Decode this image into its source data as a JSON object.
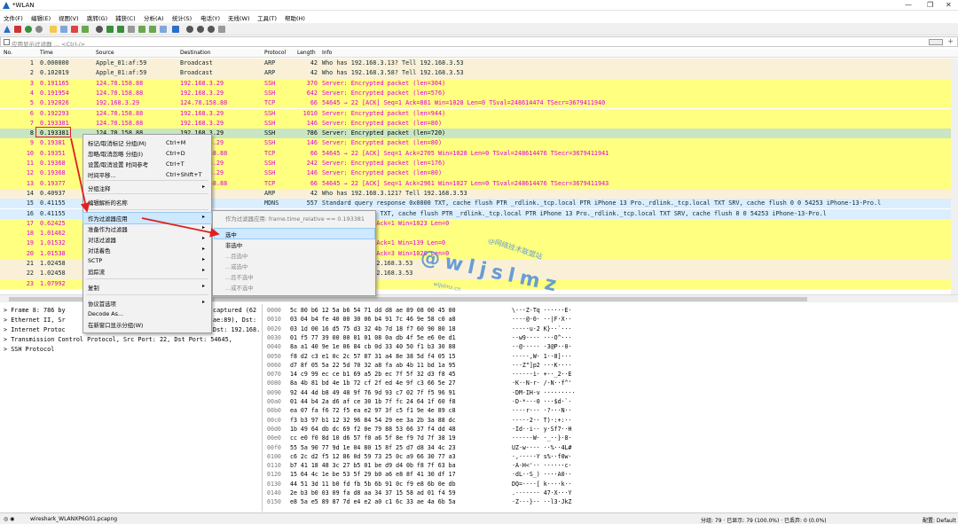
{
  "titlebar": {
    "title": "*WLAN",
    "win_min": "—",
    "win_max": "❐",
    "win_close": "✕"
  },
  "menu": [
    "文件(F)",
    "编辑(E)",
    "视图(V)",
    "跳转(G)",
    "捕获(C)",
    "分析(A)",
    "统计(S)",
    "电话(Y)",
    "无线(W)",
    "工具(T)",
    "帮助(H)"
  ],
  "filter": {
    "placeholder": "应用显示过滤器 … <Ctrl-/>"
  },
  "columns": {
    "no": "No.",
    "time": "Time",
    "source": "Source",
    "destination": "Destination",
    "protocol": "Protocol",
    "length": "Length",
    "info": "Info"
  },
  "packets": [
    {
      "no": "1",
      "time": "0.000000",
      "src": "Apple_01:af:59",
      "dst": "Broadcast",
      "proto": "ARP",
      "len": "42",
      "info": "Who has 192.168.3.13? Tell 192.168.3.53",
      "cls": "bg-arp"
    },
    {
      "no": "2",
      "time": "0.102019",
      "src": "Apple_01:af:59",
      "dst": "Broadcast",
      "proto": "ARP",
      "len": "42",
      "info": "Who has 192.168.3.58? Tell 192.168.3.53",
      "cls": "bg-arp"
    },
    {
      "no": "3",
      "time": "0.191165",
      "src": "124.70.158.88",
      "dst": "192.168.3.29",
      "proto": "SSH",
      "len": "370",
      "info": "Server: Encrypted packet (len=304)",
      "cls": "bg-ssh"
    },
    {
      "no": "4",
      "time": "0.191954",
      "src": "124.70.158.88",
      "dst": "192.168.3.29",
      "proto": "SSH",
      "len": "642",
      "info": "Server: Encrypted packet (len=576)",
      "cls": "bg-ssh"
    },
    {
      "no": "5",
      "time": "0.192026",
      "src": "192.168.3.29",
      "dst": "124.70.158.88",
      "proto": "TCP",
      "len": "66",
      "info": "54645 → 22 [ACK] Seq=1 Ack=881 Win=1028 Len=0 TSval=248614474 TSecr=3679411940",
      "cls": "bg-tcp"
    },
    {
      "no": "6",
      "time": "0.192293",
      "src": "124.70.158.88",
      "dst": "192.168.3.29",
      "proto": "SSH",
      "len": "1010",
      "info": "Server: Encrypted packet (len=944)",
      "cls": "bg-ssh"
    },
    {
      "no": "7",
      "time": "0.193381",
      "src": "124.70.158.88",
      "dst": "192.168.3.29",
      "proto": "SSH",
      "len": "146",
      "info": "Server: Encrypted packet (len=80)",
      "cls": "bg-ssh"
    },
    {
      "no": "8",
      "time": "0.193381",
      "src": "124.70.158.88",
      "dst": "192.168.3.29",
      "proto": "SSH",
      "len": "786",
      "info": "Server: Encrypted packet (len=720)",
      "cls": "bg-sel"
    },
    {
      "no": "9",
      "time": "0.19381",
      "src": "",
      "dst": "192.168.3.29",
      "proto": "SSH",
      "len": "146",
      "info": "Server: Encrypted packet (len=80)",
      "cls": "bg-ssh"
    },
    {
      "no": "10",
      "time": "0.19351",
      "src": "",
      "dst": "124.70.158.88",
      "proto": "TCP",
      "len": "66",
      "info": "54645 → 22 [ACK] Seq=1 Ack=2705 Win=1028 Len=0 TSval=248614476 TSecr=3679411941",
      "cls": "bg-tcp"
    },
    {
      "no": "11",
      "time": "0.19368",
      "src": "",
      "dst": "192.168.3.29",
      "proto": "SSH",
      "len": "242",
      "info": "Server: Encrypted packet (len=176)",
      "cls": "bg-ssh"
    },
    {
      "no": "12",
      "time": "0.19368",
      "src": "",
      "dst": "192.168.3.29",
      "proto": "SSH",
      "len": "146",
      "info": "Server: Encrypted packet (len=80)",
      "cls": "bg-ssh"
    },
    {
      "no": "13",
      "time": "0.19377",
      "src": "",
      "dst": "124.70.158.88",
      "proto": "TCP",
      "len": "66",
      "info": "54645 → 22 [ACK] Seq=1 Ack=2961 Win=1027 Len=0 TSval=248614476 TSecr=3679411943",
      "cls": "bg-tcp"
    },
    {
      "no": "14",
      "time": "0.40937",
      "src": "",
      "dst": "t",
      "proto": "ARP",
      "len": "42",
      "info": "Who has 192.168.3.121? Tell 192.168.3.53",
      "cls": "bg-arp"
    },
    {
      "no": "15",
      "time": "0.41155",
      "src": "",
      "dst": "251",
      "proto": "MDNS",
      "len": "557",
      "info": "Standard query response 0x0000 TXT, cache flush PTR _rdlink._tcp.local PTR iPhone 13 Pro._rdlink._tcp.local TXT SRV, cache flush 0 0 54253 iPhone-13-Pro.l",
      "cls": "bg-mdns"
    },
    {
      "no": "16",
      "time": "0.41155",
      "src": "",
      "dst": "",
      "proto": "",
      "len": "",
      "info": "response 0x0000 TXT, cache flush PTR _rdlink._tcp.local PTR iPhone 13 Pro._rdlink._tcp.local TXT SRV, cache flush 0 0 54253 iPhone-13-Pro.l",
      "cls": "bg-mdns"
    },
    {
      "no": "17",
      "time": "0.62425",
      "src": "",
      "dst": "",
      "proto": "",
      "len": "",
      "info": "IN, ACK] Seq=1 Ack=1 Win=1023 Len=0",
      "cls": "bg-tcp"
    },
    {
      "no": "18",
      "time": "1.01462",
      "src": "",
      "dst": "",
      "proto": "",
      "len": "",
      "info": "",
      "cls": "bg-tcp"
    },
    {
      "no": "19",
      "time": "1.01532",
      "src": "",
      "dst": "",
      "proto": "",
      "len": "",
      "info": "IN, ACK] Seq=2 Ack=1 Win=139 Len=0",
      "cls": "bg-tcp"
    },
    {
      "no": "20",
      "time": "1.01538",
      "src": "",
      "dst": "",
      "proto": "",
      "len": "",
      "info": "IN, ACK] Seq=1 Ack=3 Win=1020 Len=0",
      "cls": "bg-tcp"
    },
    {
      "no": "21",
      "time": "1.02458",
      "src": "",
      "dst": "",
      "proto": "",
      "len": "",
      "info": "8.3.13? Tell 192.168.3.53",
      "cls": "bg-arp"
    },
    {
      "no": "22",
      "time": "1.02458",
      "src": "",
      "dst": "",
      "proto": "",
      "len": "",
      "info": "8.3.58? Tell 192.168.3.53",
      "cls": "bg-arp"
    },
    {
      "no": "23",
      "time": "1.07992",
      "src": "",
      "dst": "",
      "proto": "",
      "len": "",
      "info": "",
      "cls": "bg-ssh"
    }
  ],
  "details": [
    "Frame 8: 786 by",
    "Ethernet II, Sr",
    "Internet Protoc",
    "Transmission Control Protocol, Src Port: 22, Dst Port: 54645,",
    "SSH Protocol"
  ],
  "detail_tail": [
    "captured (62",
    "ae:89), Dst:",
    "Dst: 192.168."
  ],
  "bytes": [
    {
      "off": "0000",
      "hex": "5c 80 b6 12 5a b6 54 71  dd d8 ae 89 08 00 45 00",
      "asc": "\\···Z·Tq ······E·"
    },
    {
      "off": "0010",
      "hex": "03 04 b4 fe 40 00 30 06  b4 91 7c 46 9e 58 c0 a8",
      "asc": "····@·0· ··|F·X··"
    },
    {
      "off": "0020",
      "hex": "03 1d 00 16 d5 75 d3 32  4b 7d 18 f7 60 90 80 18",
      "asc": "·····u·2 K}··`···"
    },
    {
      "off": "0030",
      "hex": "01 f5 77 39 00 00 01 01  08 0a db 4f 5e e6 0e d1",
      "asc": "··w9···· ···O^···"
    },
    {
      "off": "0040",
      "hex": "8a a1 40 9e 1e 06 84 cb  0d 33 40 50 f1 b3 30 88",
      "asc": "··@····· ·3@P··0·"
    },
    {
      "off": "0050",
      "hex": "f8 d2 c3 e1 0c 2c 57 87  31 a4 8e 38 5d f4 05 15",
      "asc": "·····,W· 1··8]···"
    },
    {
      "off": "0060",
      "hex": "d7 8f 05 5a 22 5d 70 32  a8 fa ab 4b 11 bd 1a 95",
      "asc": "···Z\"]p2 ···K····"
    },
    {
      "off": "0070",
      "hex": "14 c9 99 ec ce b1 69 a5  2b ec 7f 5f 32 d3 f8 45",
      "asc": "······i· +··_2··E"
    },
    {
      "off": "0080",
      "hex": "8a 4b 81 bd 4e 1b 72 cf  2f ed 4e 9f c3 66 5e 27",
      "asc": "·K··N·r· /·N··f^'"
    },
    {
      "off": "0090",
      "hex": "92 44 4d b8 49 48 9f 76  9d 93 c7 02 7f f5 96 91",
      "asc": "·DM·IH·v ·········"
    },
    {
      "off": "00a0",
      "hex": "01 44 b4 2a d6 af ce 30  1b 7f fc 24 64 1f 60 f8",
      "asc": "·D·*···0 ···$d·`·"
    },
    {
      "off": "00b0",
      "hex": "ea 07 fa f6 72 f5 ea e2  97 3f c5 f1 9e 4e 89 c8",
      "asc": "····r··· ·?···N··"
    },
    {
      "off": "00c0",
      "hex": "f3 b3 97 b1 12 32 96 84  54 29 ee 3a 2b 3a 88 dc",
      "asc": "·····2·· T)·:+:··"
    },
    {
      "off": "00d0",
      "hex": "1b 49 64 db dc 69 f2 0e  79 88 53 66 37 f4 dd 48",
      "asc": "·Id··i·· y·Sf7··H"
    },
    {
      "off": "00e0",
      "hex": "cc e0 f0 8d 10 d6 57 f0  a6 5f 8e f9 7d 7f 38 19",
      "asc": "······W· ·_··}·8·"
    },
    {
      "off": "00f0",
      "hex": "55 5a 90 77 9d 1e 04 80  15 8f 25 d7 d8 34 4c 23",
      "asc": "UZ·w···· ··%··4L#"
    },
    {
      "off": "0100",
      "hex": "c6 2c d2 f5 12 86 0d 59  73 25 0c a9 66 30 77 a3",
      "asc": "·,·····Y s%··f0w·"
    },
    {
      "off": "0110",
      "hex": "b7 41 18 48 3c 27 b5 01  be d9 d4 0b f8 7f 63 ba",
      "asc": "·A·H<'·· ······c·"
    },
    {
      "off": "0120",
      "hex": "15 64 4c 1e be 53 5f 29  b0 a6 e8 8f 41 30 df 17",
      "asc": "·dL··S_) ····A0··"
    },
    {
      "off": "0130",
      "hex": "44 51 3d 11 b0 fd fb 5b  6b 91 0c f9 e8 6b 0e db",
      "asc": "DQ=····[ k····k··"
    },
    {
      "off": "0140",
      "hex": "2e b3 b0 03 09 fa d8 aa  34 37 15 58 ad 01 f4 59",
      "asc": ".······· 47·X···Y"
    },
    {
      "off": "0150",
      "hex": "e8 5a e5 89 87 7d e4 e2  a0 c1 6c 33 ae 4a 6b 5a",
      "asc": "·Z···}·· ··l3·JkZ"
    }
  ],
  "context_menu": [
    {
      "label": "标记/取消标记 分组(M)",
      "shortcut": "Ctrl+M",
      "arrow": ""
    },
    {
      "label": "忽略/取消忽略 分组(I)",
      "shortcut": "Ctrl+D",
      "arrow": ""
    },
    {
      "label": "设置/取消设置 时间参考",
      "shortcut": "Ctrl+T",
      "arrow": ""
    },
    {
      "label": "时间平移...",
      "shortcut": "Ctrl+Shift+T",
      "arrow": ""
    },
    {
      "label": "分组注释",
      "shortcut": "",
      "arrow": "▸"
    },
    {
      "label": "编辑解析的名称",
      "shortcut": "",
      "arrow": ""
    },
    {
      "label": "作为过滤器应用",
      "shortcut": "",
      "arrow": "▸"
    },
    {
      "label": "准备作为过滤器",
      "shortcut": "",
      "arrow": "▸"
    },
    {
      "label": "对话过滤器",
      "shortcut": "",
      "arrow": "▸"
    },
    {
      "label": "对话着色",
      "shortcut": "",
      "arrow": "▸"
    },
    {
      "label": "SCTP",
      "shortcut": "",
      "arrow": "▸"
    },
    {
      "label": "追踪流",
      "shortcut": "",
      "arrow": "▸"
    },
    {
      "label": "复制",
      "shortcut": "",
      "arrow": "▸"
    },
    {
      "label": "协议首选项",
      "shortcut": "",
      "arrow": "▸"
    },
    {
      "label": "Decode As...",
      "shortcut": "",
      "arrow": ""
    },
    {
      "label": "在新窗口显示分组(W)",
      "shortcut": "",
      "arrow": ""
    }
  ],
  "submenu": {
    "hint": "作为过滤器应用: frame.time_relative == 0.193381",
    "items": [
      "选中",
      "非选中",
      "...且选中",
      "...或选中",
      "...且不选中",
      "...或不选中"
    ]
  },
  "watermark": {
    "arc": "@网络技术联盟站",
    "big": "@wljslmz",
    "url": "wljslmz.cn"
  },
  "status": {
    "file": "wireshark_WLANXP6G01.pcapng",
    "stats": "分组: 79 · 已显示: 79 (100.0%) · 已丢弃: 0 (0.0%)",
    "profile": "配置: Default"
  },
  "colors": {
    "selected_row": "#c8e6c4",
    "ssh_bg": "#ffff80",
    "ssh_fg": "#e000e0",
    "arp_bg": "#faf0d7",
    "mdns_bg": "#daeeff",
    "highlight": "#cde8ff",
    "annotation_red": "#e02020"
  }
}
